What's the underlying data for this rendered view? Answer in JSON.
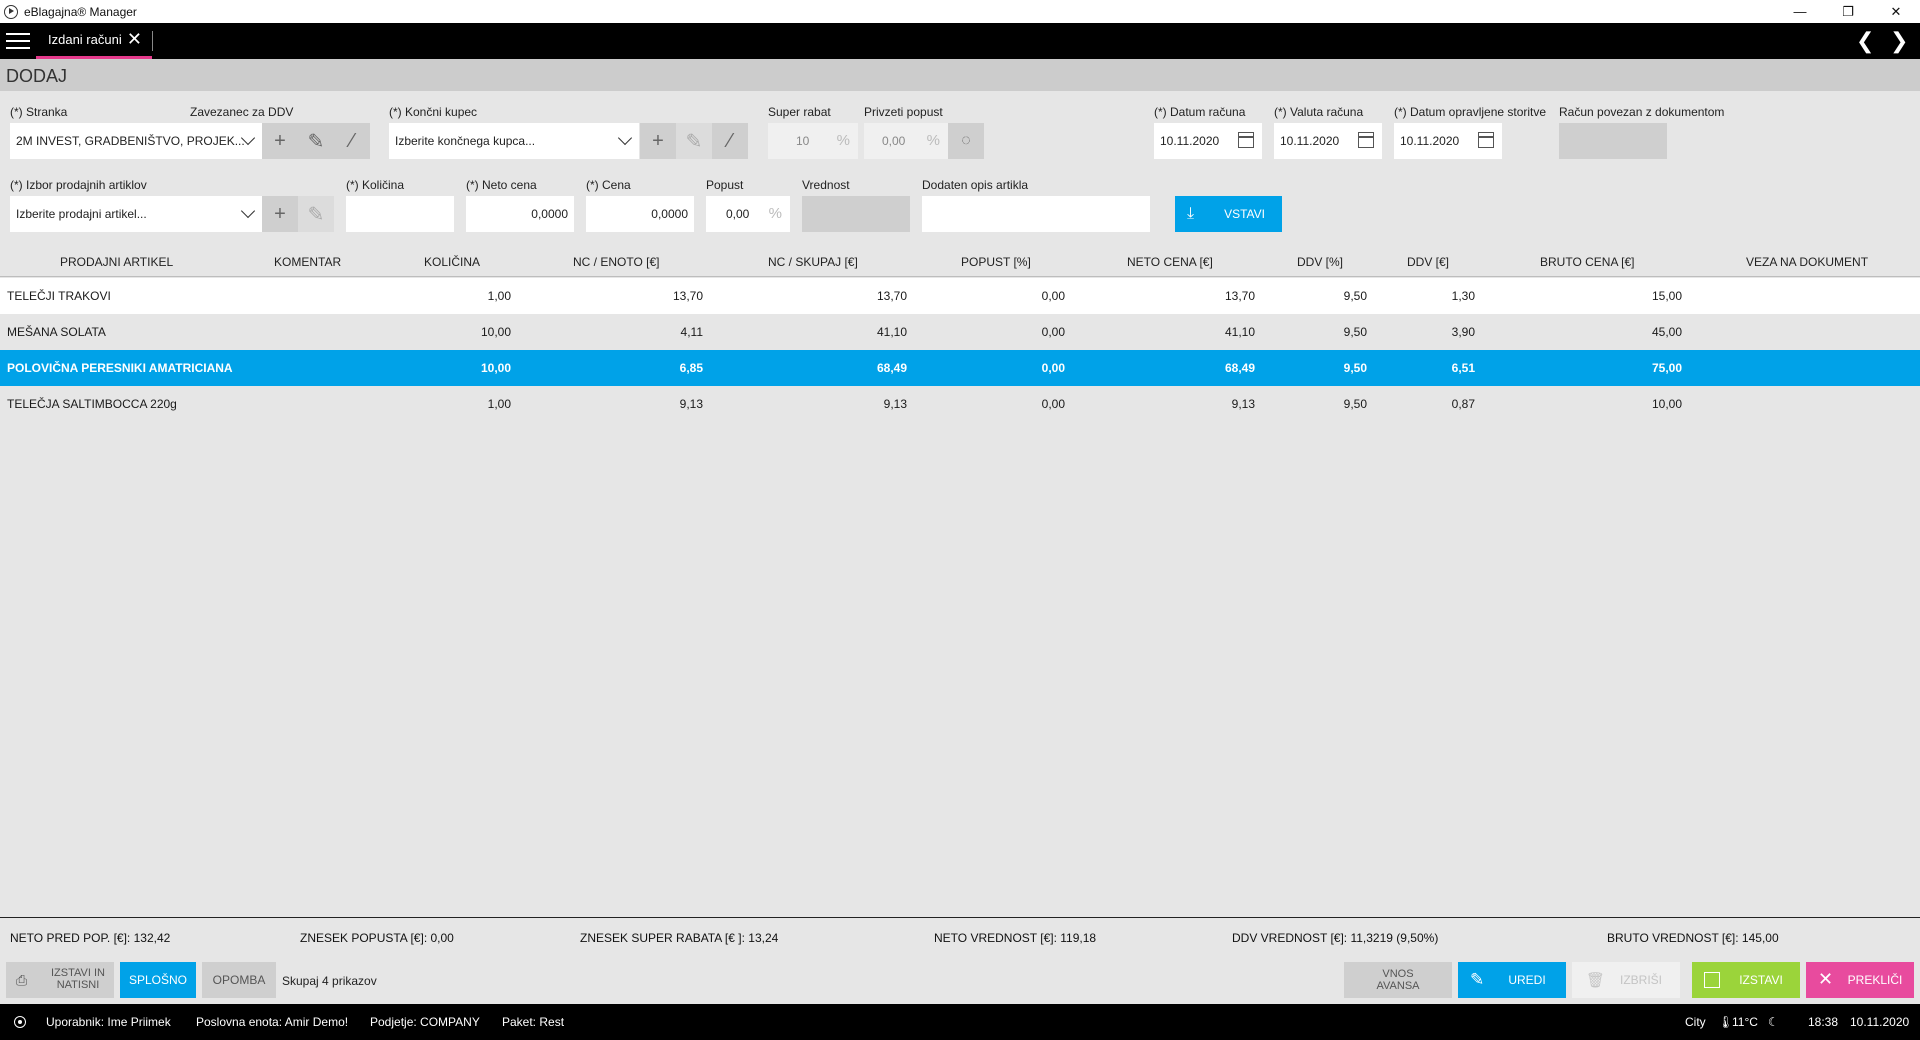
{
  "window": {
    "title": "eBlagajna® Manager",
    "controls": {
      "minimize": "—",
      "restore": "❐",
      "close": "✕"
    }
  },
  "tabbar": {
    "tab_label": "Izdani računi",
    "close_glyph": "✕",
    "prev_glyph": "❮",
    "next_glyph": "❯"
  },
  "page": {
    "title": "DODAJ"
  },
  "form": {
    "stranka": {
      "label": "(*) Stranka",
      "value": "2M INVEST, GRADBENIŠTVO, PROJEK..."
    },
    "zavezanec": {
      "label": "Zavezanec za DDV"
    },
    "koncni_kupec": {
      "label": "(*) Končni kupec",
      "placeholder": "Izberite končnega kupca..."
    },
    "super_rabat": {
      "label": "Super rabat",
      "value": "10",
      "unit": "%"
    },
    "privzeti_popust": {
      "label": "Privzeti popust",
      "value": "0,00",
      "unit": "%"
    },
    "datum_racuna": {
      "label": "(*) Datum računa",
      "value": "10.11.2020"
    },
    "valuta_racuna": {
      "label": "(*) Valuta računa",
      "value": "10.11.2020"
    },
    "datum_storitve": {
      "label": "(*) Datum opravljene storitve",
      "value": "10.11.2020"
    },
    "povezan": {
      "label": "Račun povezan z dokumentom"
    },
    "artikli": {
      "label": "(*) Izbor prodajnih artiklov",
      "placeholder": "Izberite prodajni artikel..."
    },
    "kolicina": {
      "label": "(*) Količina",
      "value": ""
    },
    "neto_cena": {
      "label": "(*) Neto cena",
      "value": "0,0000"
    },
    "cena": {
      "label": "(*) Cena",
      "value": "0,0000"
    },
    "popust": {
      "label": "Popust",
      "value": "0,00",
      "unit": "%"
    },
    "vrednost": {
      "label": "Vrednost"
    },
    "opis": {
      "label": "Dodaten opis artikla",
      "value": ""
    },
    "vstavi_label": "VSTAVI"
  },
  "table": {
    "headers": [
      "PRODAJNI ARTIKEL",
      "KOMENTAR",
      "KOLIČINA",
      "NC / ENOTO [€]",
      "NC / SKUPAJ [€]",
      "POPUST [%]",
      "NETO CENA [€]",
      "DDV [%]",
      "DDV [€]",
      "BRUTO CENA [€]",
      "VEZA NA DOKUMENT"
    ],
    "rows": [
      {
        "artikel": "TELEČJI TRAKOVI",
        "komentar": "",
        "kolicina": "1,00",
        "nc_enoto": "13,70",
        "nc_skupaj": "13,70",
        "popust": "0,00",
        "neto": "13,70",
        "ddv_pct": "9,50",
        "ddv_eur": "1,30",
        "bruto": "15,00",
        "veza": ""
      },
      {
        "artikel": "MEŠANA SOLATA",
        "komentar": "",
        "kolicina": "10,00",
        "nc_enoto": "4,11",
        "nc_skupaj": "41,10",
        "popust": "0,00",
        "neto": "41,10",
        "ddv_pct": "9,50",
        "ddv_eur": "3,90",
        "bruto": "45,00",
        "veza": ""
      },
      {
        "artikel": "POLOVIČNA PERESNIKI AMATRICIANA",
        "komentar": "",
        "kolicina": "10,00",
        "nc_enoto": "6,85",
        "nc_skupaj": "68,49",
        "popust": "0,00",
        "neto": "68,49",
        "ddv_pct": "9,50",
        "ddv_eur": "6,51",
        "bruto": "75,00",
        "veza": ""
      },
      {
        "artikel": "TELEČJA SALTIMBOCCA 220g",
        "komentar": "",
        "kolicina": "1,00",
        "nc_enoto": "9,13",
        "nc_skupaj": "9,13",
        "popust": "0,00",
        "neto": "9,13",
        "ddv_pct": "9,50",
        "ddv_eur": "0,87",
        "bruto": "10,00",
        "veza": ""
      }
    ]
  },
  "totals": {
    "neto_pred_pop": "NETO PRED POP. [€]: 132,42",
    "znesek_popusta": "ZNESEK POPUSTA [€]: 0,00",
    "znesek_super_rabata": "ZNESEK SUPER RABATA [€ ]: 13,24",
    "neto_vrednost": "NETO VREDNOST [€]: 119,18",
    "ddv_vrednost": "DDV VREDNOST [€]: 11,3219 (9,50%)",
    "bruto_vrednost": "BRUTO VREDNOST [€]: 145,00"
  },
  "actions": {
    "izstavi_natisni_1": "IZSTAVI IN",
    "izstavi_natisni_2": "NATISNI",
    "splosno": "SPLOŠNO",
    "opomba": "OPOMBA",
    "count": "Skupaj 4 prikazov",
    "vnos_avansa_1": "VNOS",
    "vnos_avansa_2": "AVANSA",
    "uredi": "UREDI",
    "izbrisi": "IZBRIŠI",
    "izstavi": "IZSTAVI",
    "preklici": "PREKLIČI"
  },
  "colors": {
    "accent": "#00a2e8",
    "tab_underline": "#e5398b",
    "izstavi_green": "#9bd43a",
    "preklici_pink": "#e84b9e"
  },
  "status": {
    "uporabnik": "Uporabnik: Ime Priimek",
    "poslovna_enota": "Poslovna enota: Amir Demo!",
    "podjetje": "Podjetje: COMPANY",
    "paket": "Paket: Rest",
    "city": "City",
    "temp": "11°C",
    "time": "18:38",
    "date": "10.11.2020"
  }
}
